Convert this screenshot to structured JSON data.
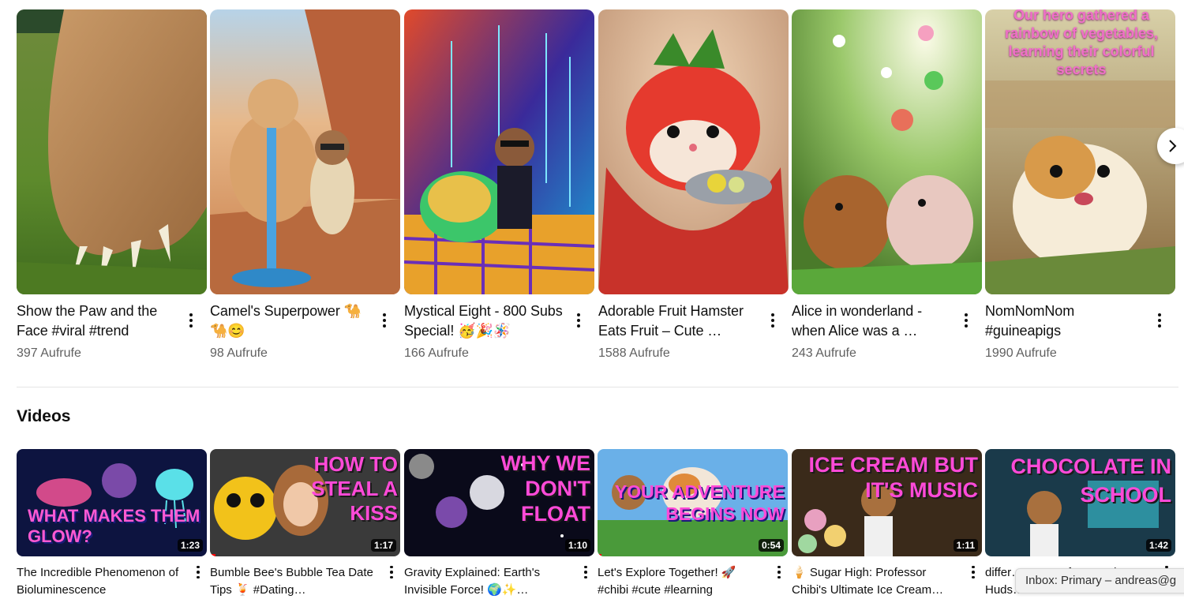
{
  "shorts": [
    {
      "title": "Show the Paw and the Face #viral #trend",
      "views": "397 Aufrufe"
    },
    {
      "title": "Camel's Superpower 🐪🐪😊",
      "views": "98 Aufrufe"
    },
    {
      "title": "Mystical Eight - 800 Subs Special! 🥳🎉🪅",
      "views": "166 Aufrufe"
    },
    {
      "title": "Adorable Fruit Hamster Eats Fruit – Cute …",
      "views": "1588 Aufrufe"
    },
    {
      "title": "Alice in wonderland - when Alice was a …",
      "views": "243 Aufrufe"
    },
    {
      "title": "NomNomNom #guineapigs",
      "views": "1990 Aufrufe",
      "overlay_text": "Our hero gathered a rainbow of vegetables, learning their colorful secrets"
    }
  ],
  "section_title": "Videos",
  "videos": [
    {
      "title": "The Incredible Phenomenon of Bioluminescence",
      "duration": "1:23",
      "thumb_text": "WHAT MAKES THEM GLOW?",
      "progress": 0
    },
    {
      "title": "Bumble Bee's Bubble Tea Date Tips 🍹 #Dating…",
      "duration": "1:17",
      "thumb_text": "HOW TO STEAL A KISS",
      "progress": 0.03
    },
    {
      "title": "Gravity Explained: Earth's Invisible Force! 🌍✨…",
      "duration": "1:10",
      "thumb_text": "WHY WE DON'T FLOAT",
      "progress": 0
    },
    {
      "title": "Let's Explore Together! 🚀 #chibi #cute #learning",
      "duration": "0:54",
      "thumb_text": "YOUR ADVENTURE BEGINS NOW",
      "progress": 0.02
    },
    {
      "title": "🍦 Sugar High: Professor Chibi's Ultimate Ice Cream…",
      "duration": "1:11",
      "thumb_text": "ICE CREAM BUT IT'S MUSIC",
      "progress": 0
    },
    {
      "title": "differ… secrets from ancient Huds…",
      "duration": "1:42",
      "thumb_text": "CHOCOLATE IN SCHOOL",
      "progress": 0
    }
  ],
  "toast": "Inbox: Primary – andreas@g",
  "icons": {
    "more": "more-vert-icon",
    "next": "chevron-right-icon"
  }
}
